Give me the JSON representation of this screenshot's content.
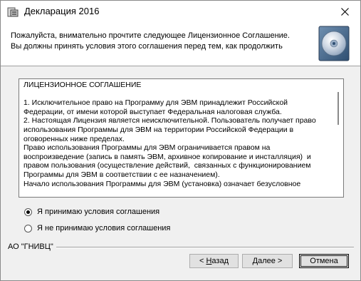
{
  "window": {
    "title": "Декларация 2016"
  },
  "header": {
    "instruction": "Пожалуйста, внимательно прочтите следующее Лицензионное Соглашение. Вы должны принять условия этого соглашения перед тем, как продолжить"
  },
  "license": {
    "text": "ЛИЦЕНЗИОННОЕ СОГЛАШЕНИЕ\n\n1. Исключительное право на Программу для ЭВМ принадлежит Российской Федерации, от имени которой выступает Федеральная налоговая служба.\n2. Настоящая Лицензия является неисключительной. Пользователь получает право использования Программы для ЭВМ на территории Российской Федерации в оговоренных ниже пределах.\nПраво использования Программы для ЭВМ ограничивается правом на воспроизведение (запись в память ЭВМ, архивное копирование и инсталляция)  и правом пользования (осуществление действий,  связанных с функционированием Программы для ЭВМ в соответствии с ее назначением).\nНачало использования Программы для ЭВМ (установка) означает безусловное"
  },
  "options": {
    "accept": {
      "label": "Я принимаю условия соглашения",
      "selected": true
    },
    "decline": {
      "label": "Я не принимаю условия соглашения",
      "selected": false
    }
  },
  "footer": {
    "vendor": "АО \"ГНИВЦ\""
  },
  "buttons": {
    "back": {
      "prefix": "< ",
      "mnemonic": "Н",
      "rest": "азад"
    },
    "next": {
      "mnemonic": "Д",
      "rest": "алее",
      "suffix": " >"
    },
    "cancel": {
      "label": "Отмена"
    }
  },
  "icons": {
    "app": "installer-app-icon",
    "close": "close-icon",
    "header": "cd-disc-icon"
  }
}
